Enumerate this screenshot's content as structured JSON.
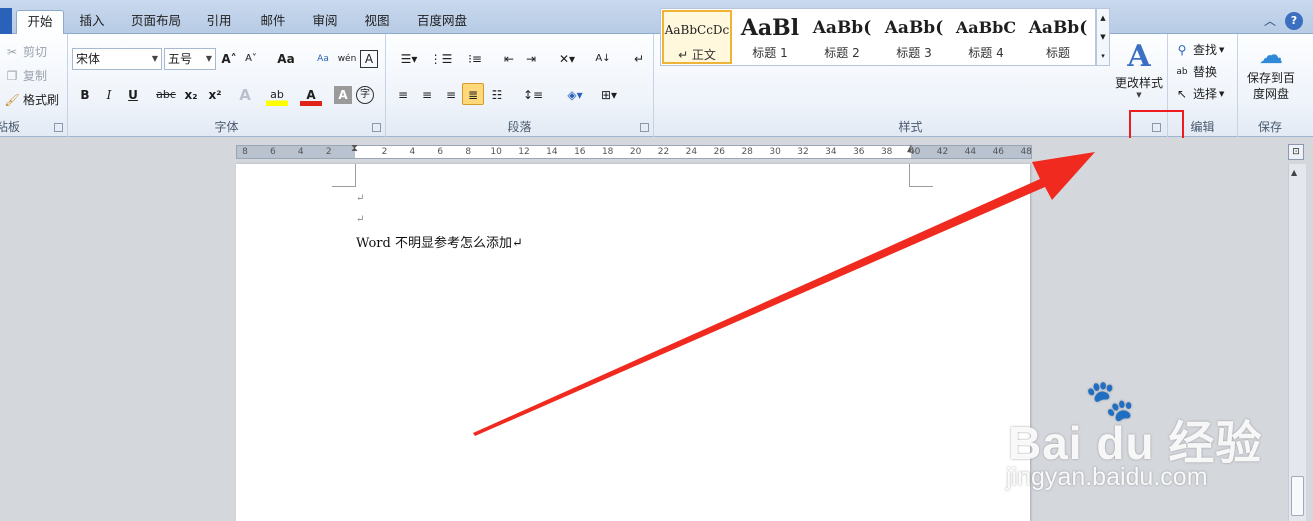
{
  "tabs": [
    "开始",
    "插入",
    "页面布局",
    "引用",
    "邮件",
    "审阅",
    "视图",
    "百度网盘"
  ],
  "window": {
    "minimize": "︿",
    "help": "?"
  },
  "clipboard": {
    "cut": "剪切",
    "copy": "复制",
    "format_painter": "格式刷",
    "label": "粘板"
  },
  "font": {
    "name": "宋体",
    "size": "五号",
    "grow": "A˄",
    "shrink": "A˅",
    "case": "Aa",
    "pinyin": "wén",
    "border_char": "A",
    "bold": "B",
    "italic": "I",
    "underline": "U",
    "strike": "abc",
    "subscript": "x₂",
    "superscript": "x²",
    "text_effect": "A",
    "highlight": "ab",
    "font_color": "A",
    "shading": "A",
    "enclose": "字",
    "label": "字体"
  },
  "paragraph": {
    "label": "段落"
  },
  "styles": {
    "items": [
      {
        "sample": "AaBbCcDc",
        "name": "↵ 正文"
      },
      {
        "sample": "AaBl",
        "name": "标题 1"
      },
      {
        "sample": "AaBb(",
        "name": "标题 2"
      },
      {
        "sample": "AaBb(",
        "name": "标题 3"
      },
      {
        "sample": "AaBbC",
        "name": "标题 4"
      },
      {
        "sample": "AaBb(",
        "name": "标题"
      }
    ],
    "change_styles": "更改样式",
    "label": "样式"
  },
  "editing": {
    "find": "查找",
    "replace": "替换",
    "select": "选择",
    "label": "编辑"
  },
  "save_baidu": {
    "line1": "保存到百",
    "line2": "度网盘",
    "label": "保存"
  },
  "ruler": [
    "8",
    "6",
    "4",
    "2",
    "",
    "2",
    "4",
    "6",
    "8",
    "10",
    "12",
    "14",
    "16",
    "18",
    "20",
    "22",
    "24",
    "26",
    "28",
    "30",
    "32",
    "34",
    "36",
    "38",
    "40",
    "42",
    "44",
    "46",
    "48"
  ],
  "document": {
    "paragraphs": [
      "↵",
      "↵",
      "Word 不明显参考怎么添加↵"
    ]
  },
  "watermark": {
    "brand": "Bai du 经验",
    "url": "jingyan.baidu.com"
  },
  "colors": {
    "accent": "#2a62b9",
    "highlight_box": "#ee1c1c",
    "arrow": "#f02a1e"
  }
}
